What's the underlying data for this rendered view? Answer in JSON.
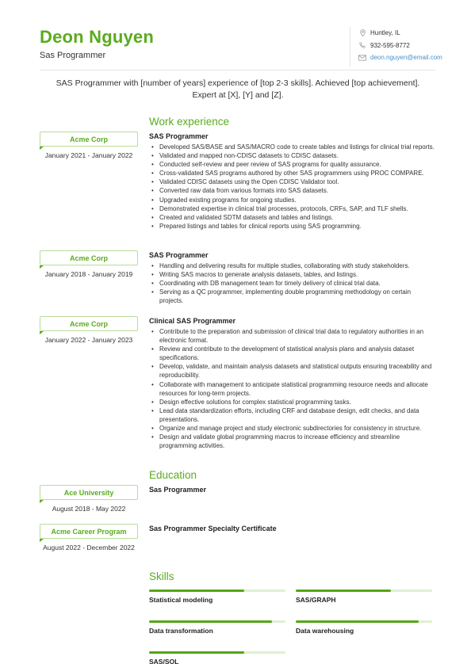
{
  "header": {
    "name": "Deon Nguyen",
    "title": "Sas Programmer",
    "contact": {
      "location": "Huntley, IL",
      "phone": "932-595-8772",
      "email": "deon.nguyen@email.com"
    }
  },
  "summary": "SAS Programmer with [number of years] experience of [top 2-3 skills]. Achieved [top achievement]. Expert at [X], [Y] and [Z].",
  "work": {
    "heading": "Work experience",
    "jobs": [
      {
        "company": "Acme Corp",
        "dates": "January 2021 - January 2022",
        "title": "SAS Programmer",
        "bullets": [
          "Developed SAS/BASE and SAS/MACRO code to create tables and listings for clinical trial reports.",
          "Validated and mapped non-CDISC datasets to CDISC datasets.",
          "Conducted self-review and peer review of SAS programs for quality assurance.",
          "Cross-validated SAS programs authored by other SAS programmers using PROC COMPARE.",
          "Validated CDISC datasets using the Open CDISC Validator tool.",
          "Converted raw data from various formats into SAS datasets.",
          "Upgraded existing programs for ongoing studies.",
          "Demonstrated expertise in clinical trial processes, protocols, CRFs, SAP, and TLF shells.",
          "Created and validated SDTM datasets and tables and listings.",
          "Prepared listings and tables for clinical reports using SAS programming."
        ]
      },
      {
        "company": "Acme Corp",
        "dates": "January 2018 - January 2019",
        "title": "SAS Programmer",
        "bullets": [
          "Handling and delivering results for multiple studies, collaborating with study stakeholders.",
          "Writing SAS macros to generate analysis datasets, tables, and listings.",
          "Coordinating with DB management team for timely delivery of clinical trial data.",
          "Serving as a QC programmer, implementing double programming methodology on certain projects."
        ]
      },
      {
        "company": "Acme Corp",
        "dates": "January 2022 - January 2023",
        "title": "Clinical SAS Programmer",
        "bullets": [
          "Contribute to the preparation and submission of clinical trial data to regulatory authorities in an electronic format.",
          "Review and contribute to the development of statistical analysis plans and analysis dataset specifications.",
          "Develop, validate, and maintain analysis datasets and statistical outputs ensuring traceability and reproducibility.",
          "Collaborate with management to anticipate statistical programming resource needs and allocate resources for long-term projects.",
          "Design effective solutions for complex statistical programming tasks.",
          "Lead data standardization efforts, including CRF and database design, edit checks, and data presentations.",
          "Organize and manage project and study electronic subdirectories for consistency in structure.",
          "Design and validate global programming macros to increase efficiency and streamline programming activities."
        ]
      }
    ]
  },
  "education": {
    "heading": "Education",
    "items": [
      {
        "school": "Ace University",
        "dates": "August 2018 - May 2022",
        "degree": "Sas Programmer"
      },
      {
        "school": "Acme Career Program",
        "dates": "August 2022 - December 2022",
        "degree": "Sas Programmer Specialty Certificate"
      }
    ]
  },
  "skills": {
    "heading": "Skills",
    "items": [
      {
        "name": "Statistical modeling",
        "level": 0.7
      },
      {
        "name": "SAS/GRAPH",
        "level": 0.7
      },
      {
        "name": "Data transformation",
        "level": 0.9
      },
      {
        "name": "Data warehousing",
        "level": 0.9
      },
      {
        "name": "SAS/SQL",
        "level": 0.7
      }
    ]
  },
  "icons": {
    "location": "location-pin-icon",
    "phone": "phone-icon",
    "email": "envelope-icon"
  },
  "colors": {
    "accent": "#5aab1e",
    "bar_fill": "#55a614",
    "bar_track": "#e0efd3",
    "link": "#4a90c9"
  }
}
